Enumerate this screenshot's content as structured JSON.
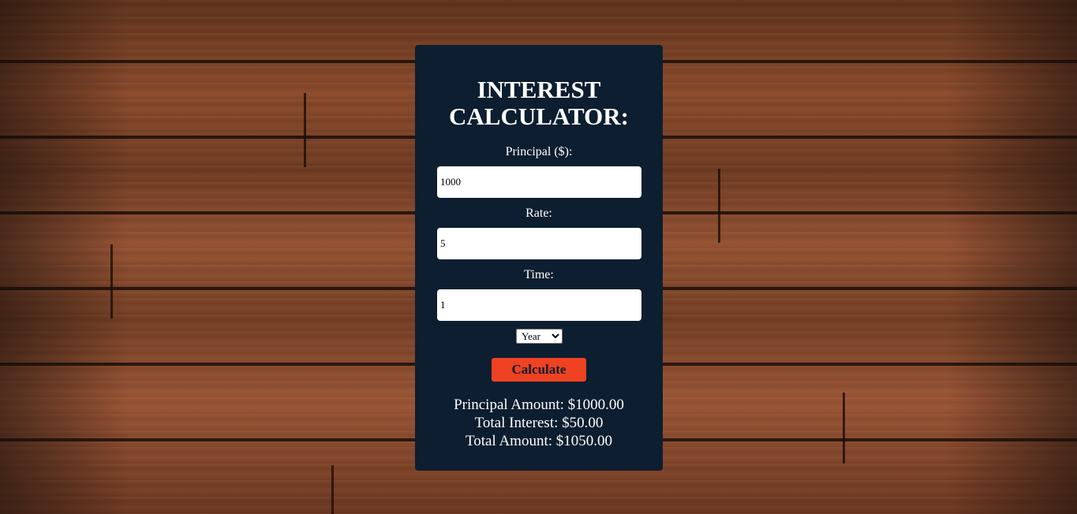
{
  "title": "INTEREST CALCULATOR:",
  "principal": {
    "label": "Principal ($):",
    "value": "1000"
  },
  "rate": {
    "label": "Rate:",
    "value": "5"
  },
  "time": {
    "label": "Time:",
    "value": "1"
  },
  "time_unit": {
    "selected": "Year",
    "options": [
      "Year"
    ]
  },
  "calculate_label": "Calculate",
  "results": {
    "principal_amount": "Principal Amount: $1000.00",
    "total_interest": "Total Interest: $50.00",
    "total_amount": "Total Amount: $1050.00"
  },
  "colors": {
    "card_bg": "#0c1e30",
    "button_bg": "#ef4222",
    "text": "#ffffff"
  }
}
